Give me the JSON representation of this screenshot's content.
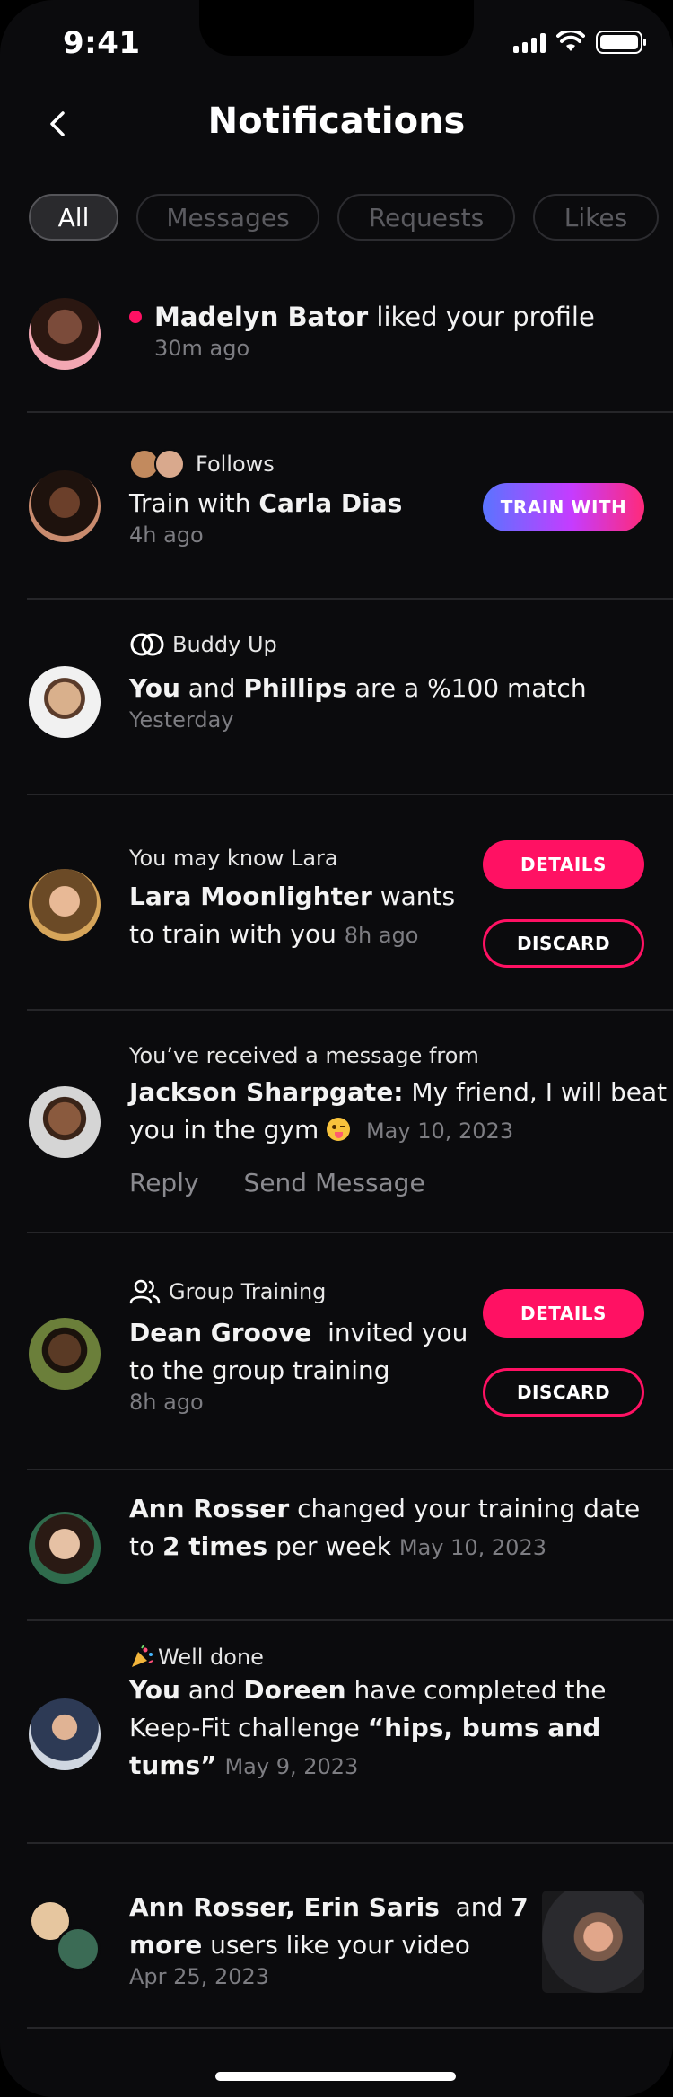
{
  "status": {
    "time": "9:41"
  },
  "header": {
    "title": "Notifications"
  },
  "tabs": [
    {
      "label": "All"
    },
    {
      "label": "Messages"
    },
    {
      "label": "Requests"
    },
    {
      "label": "Likes"
    }
  ],
  "notifications": {
    "n1": {
      "name": "Madelyn Bator",
      "action": " liked your profile",
      "time": "30m ago"
    },
    "n2": {
      "category": "Follows",
      "prefix": "Train with ",
      "name": "Carla Dias",
      "time": "4h ago",
      "button": "TRAIN WITH"
    },
    "n3": {
      "category": "Buddy Up",
      "you": "You",
      "and": " and ",
      "name": "Phillips",
      "suffix": " are a %100 match",
      "time": "Yesterday"
    },
    "n4": {
      "category": "You may know Lara",
      "name": "Lara Moonlighter",
      "line1_suffix": " wants",
      "line2": "to train with you",
      "time": "8h ago",
      "details": "DETAILS",
      "discard": "DISCARD"
    },
    "n5": {
      "category": "You’ve received a message from",
      "name": "Jackson Sharpgate:",
      "line1_suffix": " My friend, I will beat",
      "line2": "you in the gym",
      "time": "May 10, 2023",
      "reply": "Reply",
      "send": "Send Message"
    },
    "n6": {
      "category": "Group Training",
      "name": "Dean Groove",
      "line1_suffix": "  invited you",
      "line2": "to the group training",
      "time": "8h ago",
      "details": "DETAILS",
      "discard": "DISCARD"
    },
    "n7": {
      "name": "Ann Rosser",
      "line1_suffix": " changed your training date",
      "line2_prefix": "to ",
      "bold2": "2 times",
      "line2_suffix": " per week",
      "time": "May 10, 2023"
    },
    "n8": {
      "category": "Well done",
      "you": "You",
      "and": " and ",
      "name": "Doreen",
      "line1_suffix": " have completed the",
      "line2": "Keep-Fit challenge ",
      "bold2": "“hips, bums and",
      "bold3": "tums”",
      "time": "May 9, 2023"
    },
    "n9": {
      "names": "Ann Rosser, Erin Saris",
      "and": "  and ",
      "count": "7",
      "more": "more",
      "line2_suffix": " users like your video",
      "time": "Apr 25, 2023"
    }
  },
  "colors": {
    "accent": "#ff1163",
    "background": "#0b0b0d",
    "divider": "#262629"
  }
}
